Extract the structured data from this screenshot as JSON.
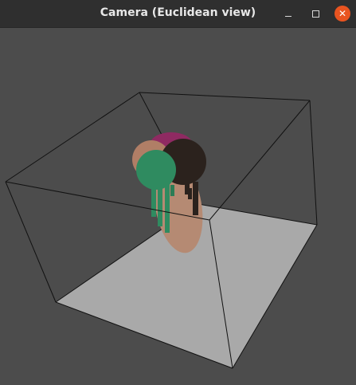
{
  "window": {
    "title": "Camera (Euclidean view)"
  },
  "controls": {
    "minimize": "minimize-icon",
    "maximize": "maximize-icon",
    "close": "close-icon"
  },
  "colors": {
    "titlebar": "#2f2f2f",
    "close_button": "#e95420",
    "viewport_background": "#4c4c4c",
    "floor": "#a9a9a9",
    "box_edges": "#111111",
    "body_peach": "#b58a73",
    "sphere_green": "#2f8b60",
    "sphere_dark": "#2b221d",
    "sphere_magenta": "#8f2a62"
  }
}
